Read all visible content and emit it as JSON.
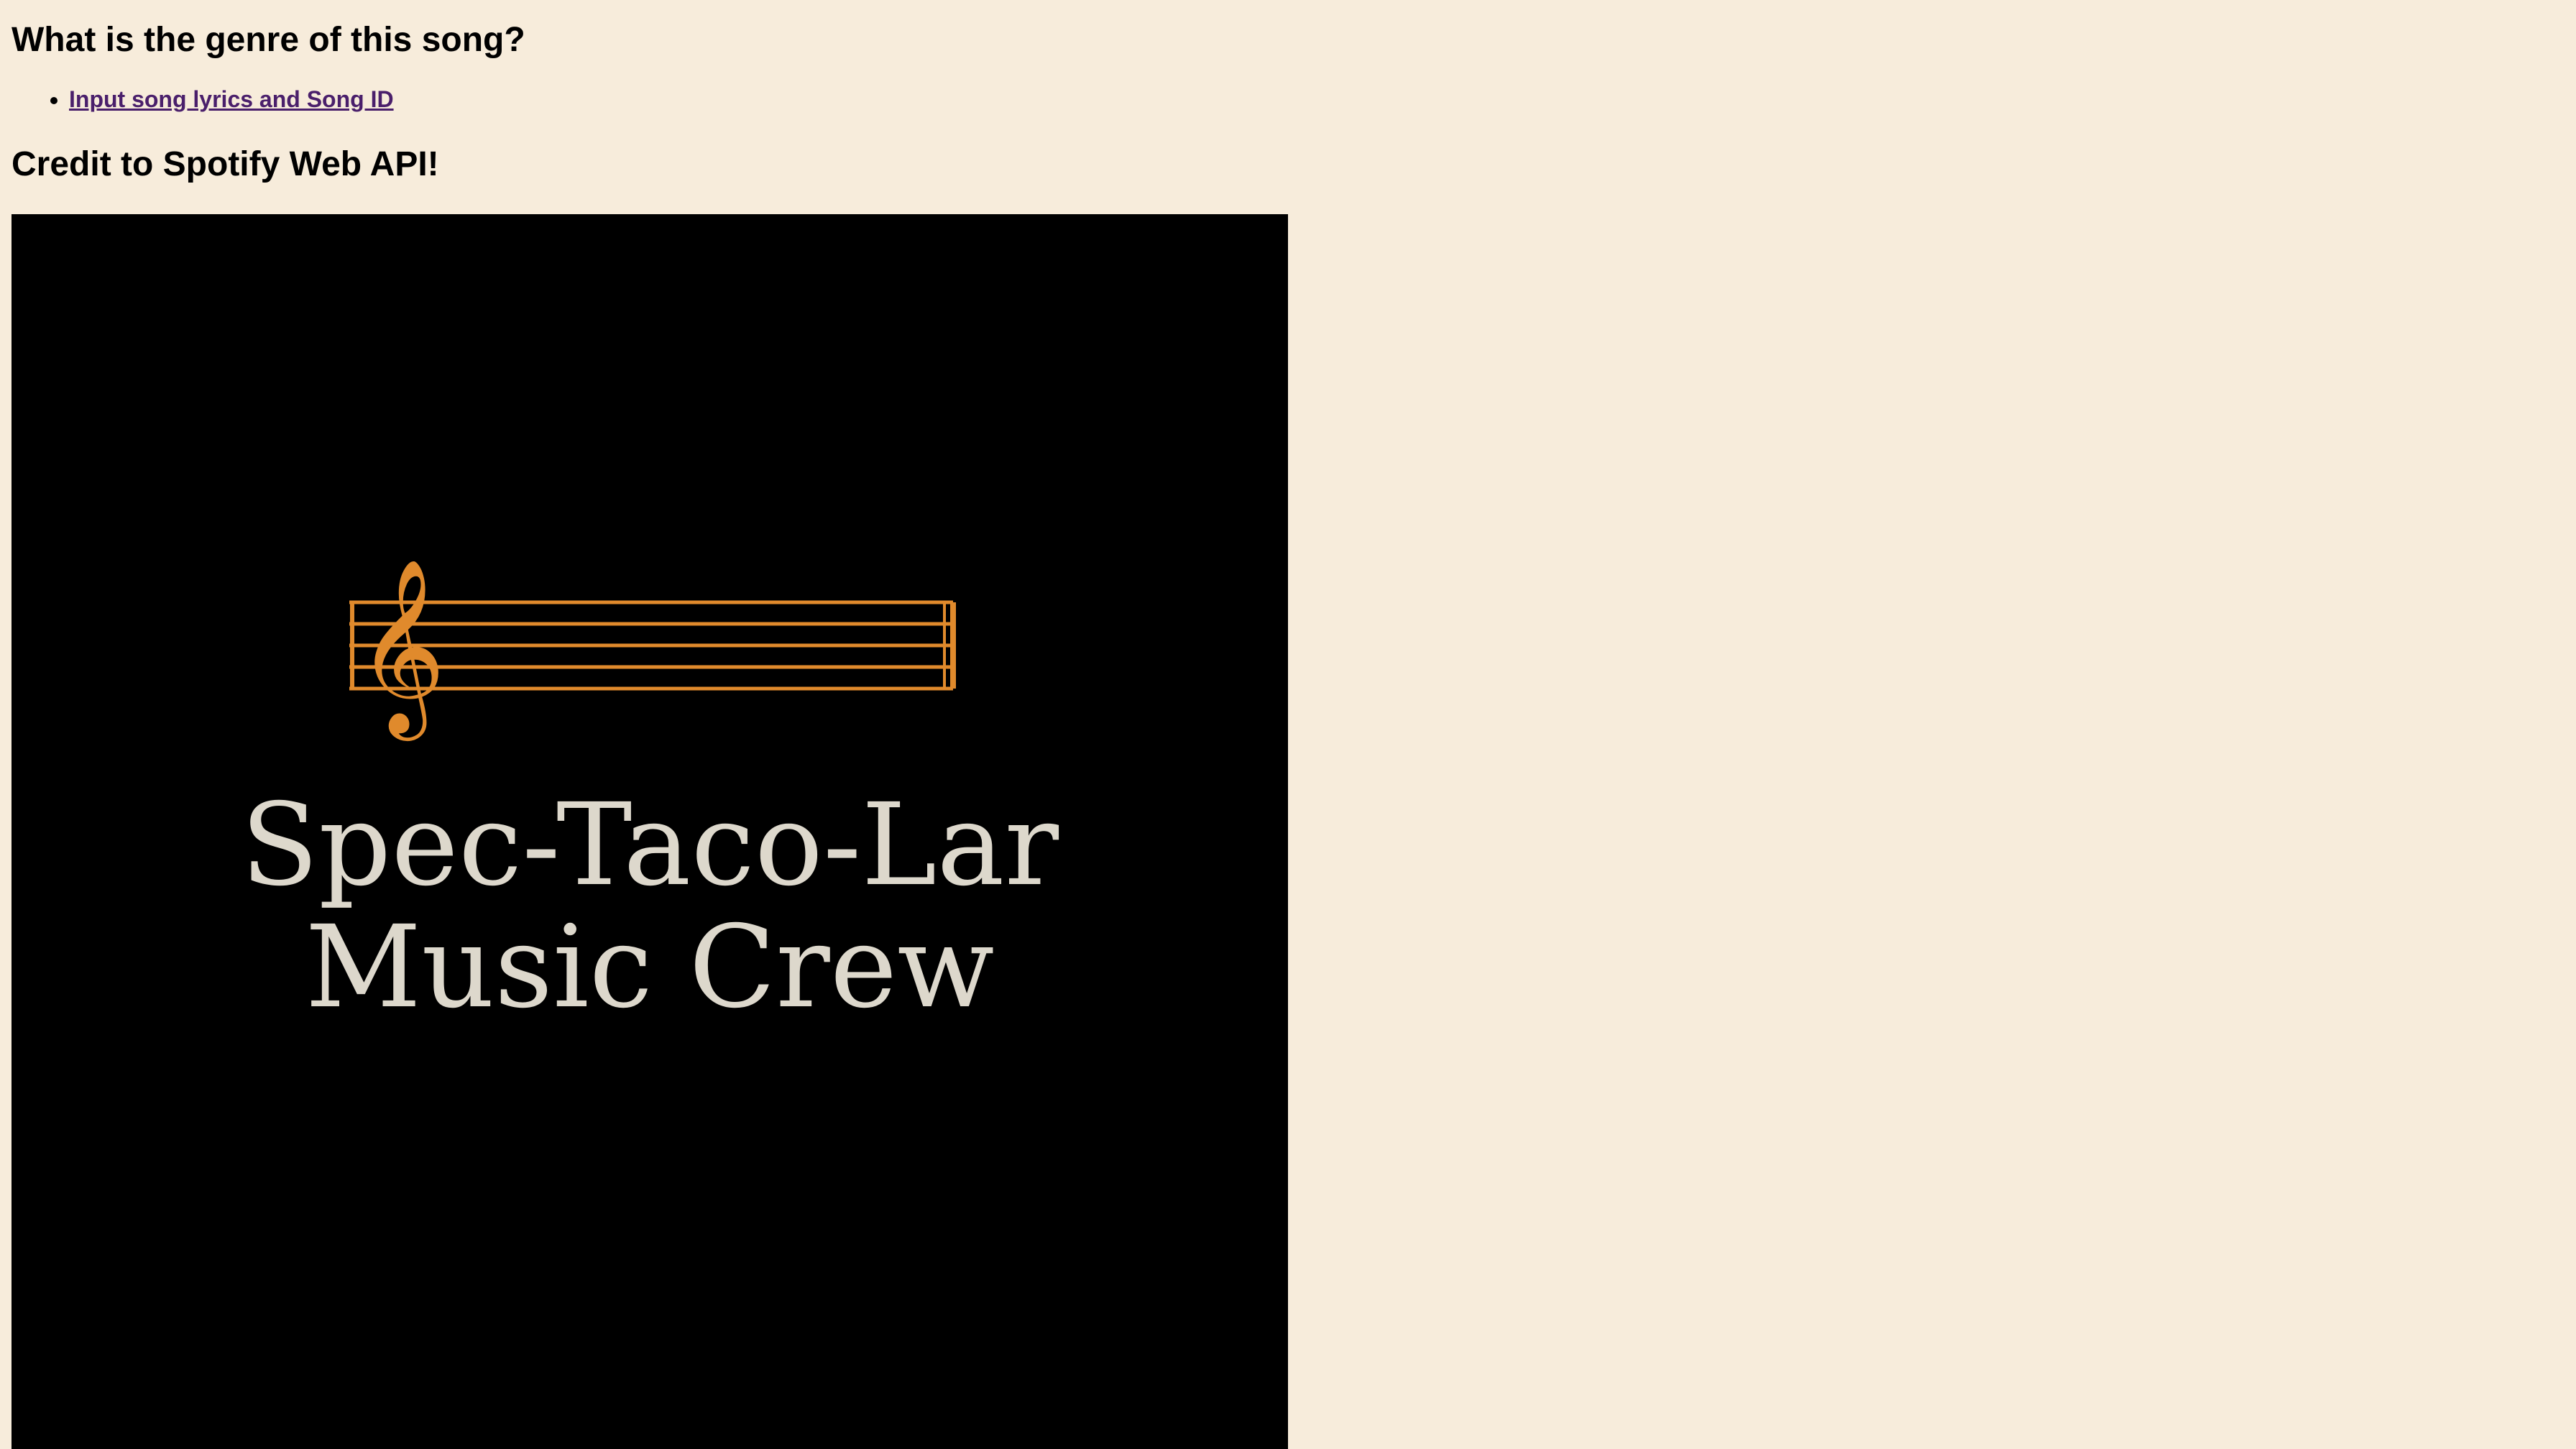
{
  "page": {
    "title": "What is the genre of this song?",
    "links": [
      {
        "label": "Input song lyrics and Song ID"
      }
    ],
    "credit": "Credit to Spotify Web API!"
  },
  "logo": {
    "line1": "Spec-Taco-Lar",
    "line2": "Music Crew",
    "icon": "treble-clef-staff-icon",
    "colors": {
      "background": "#000000",
      "staff": "#e08a2c",
      "text": "#ddd8cc"
    }
  },
  "colors": {
    "page_background": "#f7ecdb",
    "link": "#4a1f6b"
  }
}
